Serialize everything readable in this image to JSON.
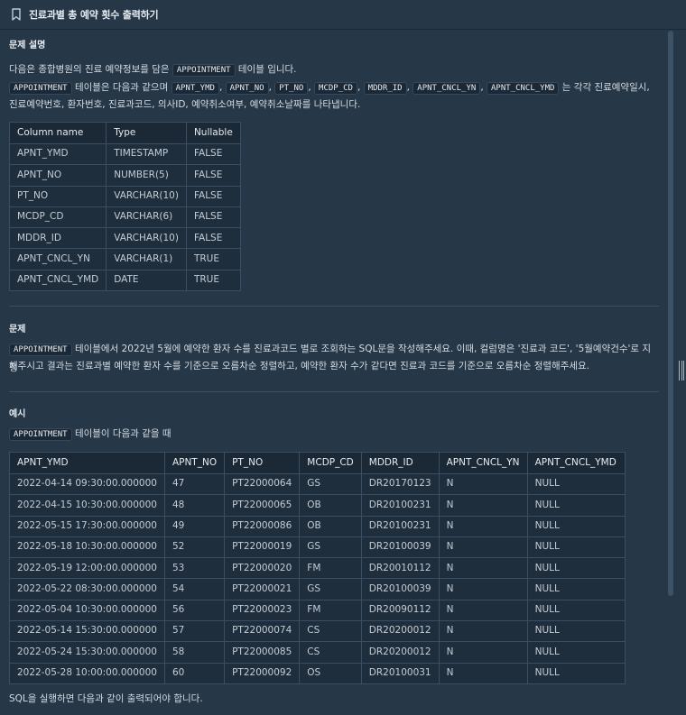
{
  "header": {
    "title": "진료과별 총 예약 횟수 출력하기",
    "icon": "bookmark-icon"
  },
  "description": {
    "heading": "문제 설명",
    "line1_pre": "다음은 종합병원의 진료 예약정보를 담은",
    "line1_code": "APPOINTMENT",
    "line1_post": "테이블 입니다.",
    "line2_code_table": "APPOINTMENT",
    "line2_mid": "테이블은 다음과 같으며",
    "line2_codes": [
      "APNT_YMD",
      "APNT_NO",
      "PT_NO",
      "MCDP_CD",
      "MDDR_ID",
      "APNT_CNCL_YN",
      "APNT_CNCL_YMD"
    ],
    "line2_sep": ",",
    "line2_post": "는 각각 진료예약일시,",
    "line3": "진료예약번호, 환자번호, 진료과코드, 의사ID, 예약취소여부, 예약취소날짜를 나타냅니다."
  },
  "schema": {
    "headers": [
      "Column name",
      "Type",
      "Nullable"
    ],
    "rows": [
      [
        "APNT_YMD",
        "TIMESTAMP",
        "FALSE"
      ],
      [
        "APNT_NO",
        "NUMBER(5)",
        "FALSE"
      ],
      [
        "PT_NO",
        "VARCHAR(10)",
        "FALSE"
      ],
      [
        "MCDP_CD",
        "VARCHAR(6)",
        "FALSE"
      ],
      [
        "MDDR_ID",
        "VARCHAR(10)",
        "FALSE"
      ],
      [
        "APNT_CNCL_YN",
        "VARCHAR(1)",
        "TRUE"
      ],
      [
        "APNT_CNCL_YMD",
        "DATE",
        "TRUE"
      ]
    ]
  },
  "problem": {
    "heading": "문제",
    "code": "APPOINTMENT",
    "line1": "테이블에서 2022년 5월에 예약한 환자 수를 진료과코드 별로 조회하는 SQL문을 작성해주세요. 이때, 컬럼명은 '진료과 코드', '5월예약건수'로 지정",
    "line2": "해주시고 결과는 진료과별 예약한 환자 수를 기준으로 오름차순 정렬하고, 예약한 환자 수가 같다면 진료과 코드를 기준으로 오름차순 정렬해주세요."
  },
  "example": {
    "heading": "예시",
    "code": "APPOINTMENT",
    "caption": "테이블이 다음과 같을 때",
    "headers": [
      "APNT_YMD",
      "APNT_NO",
      "PT_NO",
      "MCDP_CD",
      "MDDR_ID",
      "APNT_CNCL_YN",
      "APNT_CNCL_YMD"
    ],
    "rows": [
      [
        "2022-04-14 09:30:00.000000",
        "47",
        "PT22000064",
        "GS",
        "DR20170123",
        "N",
        "NULL"
      ],
      [
        "2022-04-15 10:30:00.000000",
        "48",
        "PT22000065",
        "OB",
        "DR20100231",
        "N",
        "NULL"
      ],
      [
        "2022-05-15 17:30:00.000000",
        "49",
        "PT22000086",
        "OB",
        "DR20100231",
        "N",
        "NULL"
      ],
      [
        "2022-05-18 10:30:00.000000",
        "52",
        "PT22000019",
        "GS",
        "DR20100039",
        "N",
        "NULL"
      ],
      [
        "2022-05-19 12:00:00.000000",
        "53",
        "PT22000020",
        "FM",
        "DR20010112",
        "N",
        "NULL"
      ],
      [
        "2022-05-22 08:30:00.000000",
        "54",
        "PT22000021",
        "GS",
        "DR20100039",
        "N",
        "NULL"
      ],
      [
        "2022-05-04 10:30:00.000000",
        "56",
        "PT22000023",
        "FM",
        "DR20090112",
        "N",
        "NULL"
      ],
      [
        "2022-05-14 15:30:00.000000",
        "57",
        "PT22000074",
        "CS",
        "DR20200012",
        "N",
        "NULL"
      ],
      [
        "2022-05-24 15:30:00.000000",
        "58",
        "PT22000085",
        "CS",
        "DR20200012",
        "N",
        "NULL"
      ],
      [
        "2022-05-28 10:00:00.000000",
        "60",
        "PT22000092",
        "OS",
        "DR20100031",
        "N",
        "NULL"
      ]
    ],
    "footer": "SQL을 실행하면 다음과 같이 출력되어야 합니다."
  }
}
